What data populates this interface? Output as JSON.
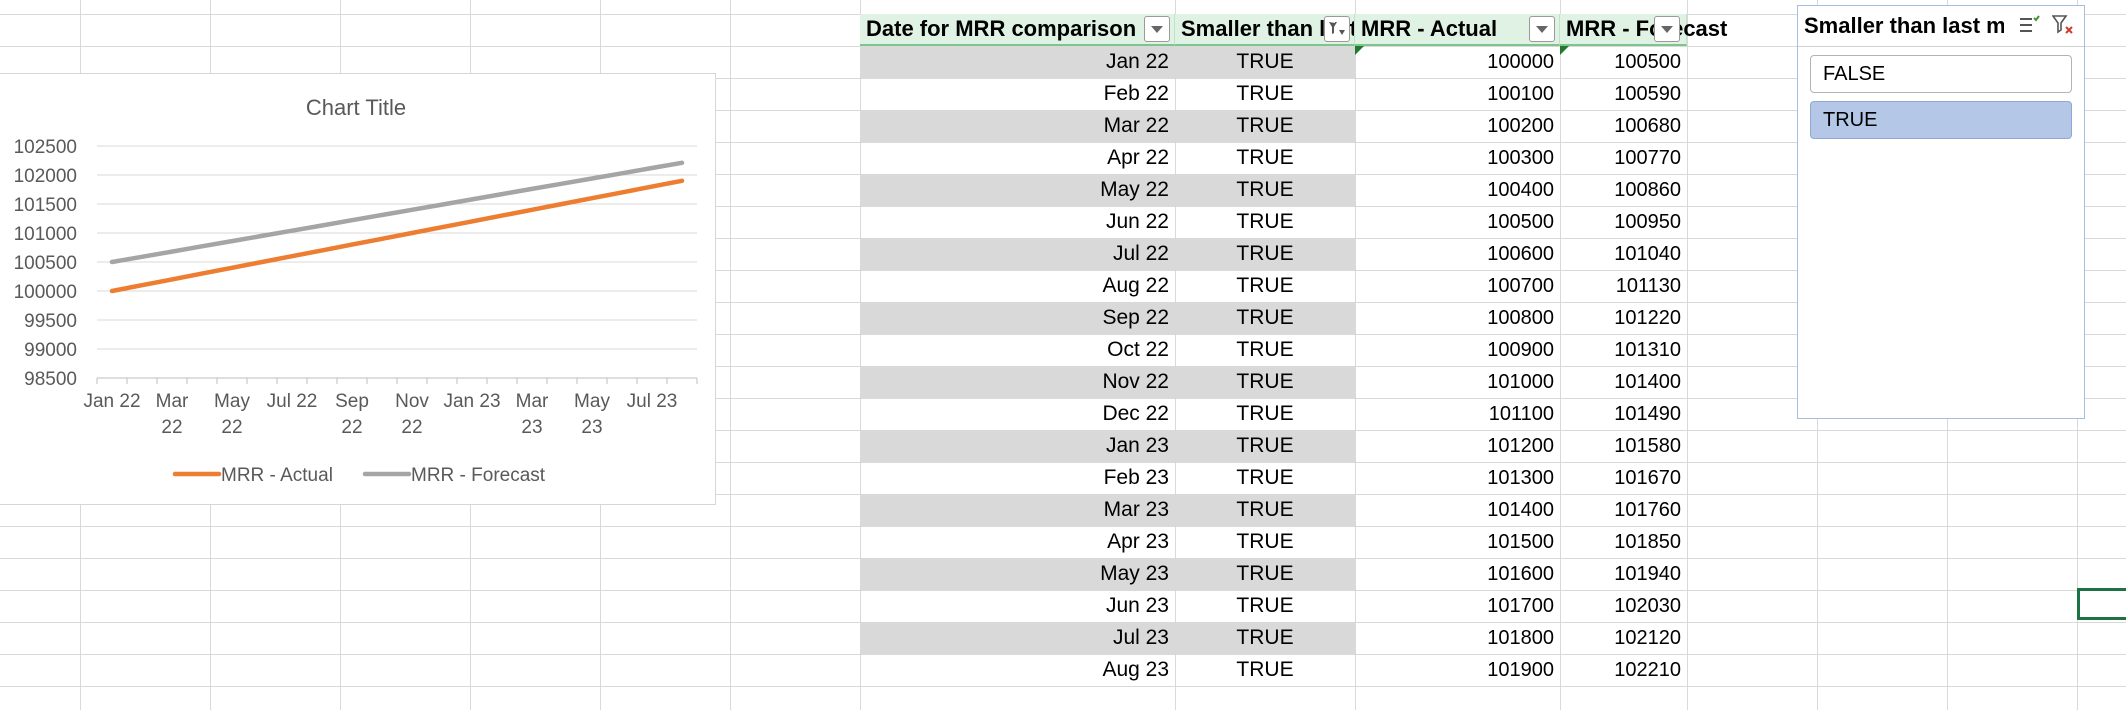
{
  "colors": {
    "actual": "#ed7d31",
    "forecast": "#a5a5a5",
    "header_fill": "#dff2e3",
    "band_fill": "#d9d9d9",
    "slicer_selected": "#b4c7e7",
    "active_cell": "#1e7145"
  },
  "chart_data": {
    "type": "line",
    "title": "Chart Title",
    "xlabel": "",
    "ylabel": "",
    "ylim": [
      98500,
      102500
    ],
    "yticks": [
      "102500",
      "102000",
      "101500",
      "101000",
      "100500",
      "100000",
      "99500",
      "99000",
      "98500"
    ],
    "categories": [
      "Jan 22",
      "Feb 22",
      "Mar 22",
      "Apr 22",
      "May 22",
      "Jun 22",
      "Jul 22",
      "Aug 22",
      "Sep 22",
      "Oct 22",
      "Nov 22",
      "Dec 22",
      "Jan 23",
      "Feb 23",
      "Mar 23",
      "Apr 23",
      "May 23",
      "Jun 23",
      "Jul 23",
      "Aug 23"
    ],
    "xtick_labels": [
      [
        "Jan 22"
      ],
      [
        "Mar",
        "22"
      ],
      [
        "May",
        "22"
      ],
      [
        "Jul 22"
      ],
      [
        "Sep",
        "22"
      ],
      [
        "Nov",
        "22"
      ],
      [
        "Jan 23"
      ],
      [
        "Mar",
        "23"
      ],
      [
        "May",
        "23"
      ],
      [
        "Jul 23"
      ]
    ],
    "series": [
      {
        "name": "MRR - Actual",
        "values": [
          100000,
          100100,
          100200,
          100300,
          100400,
          100500,
          100600,
          100700,
          100800,
          100900,
          101000,
          101100,
          101200,
          101300,
          101400,
          101500,
          101600,
          101700,
          101800,
          101900
        ]
      },
      {
        "name": "MRR - Forecast",
        "values": [
          100500,
          100590,
          100680,
          100770,
          100860,
          100950,
          101040,
          101130,
          101220,
          101310,
          101400,
          101490,
          101580,
          101670,
          101760,
          101850,
          101940,
          102030,
          102120,
          102210
        ]
      }
    ],
    "grid": true,
    "legend": "bottom"
  },
  "table": {
    "headers": [
      "Date for MRR comparison",
      "Smaller than last month",
      "MRR - Actual",
      "MRR - Forecast"
    ],
    "rows": [
      [
        "Jan 22",
        "TRUE",
        "100000",
        "100500"
      ],
      [
        "Feb 22",
        "TRUE",
        "100100",
        "100590"
      ],
      [
        "Mar 22",
        "TRUE",
        "100200",
        "100680"
      ],
      [
        "Apr 22",
        "TRUE",
        "100300",
        "100770"
      ],
      [
        "May 22",
        "TRUE",
        "100400",
        "100860"
      ],
      [
        "Jun 22",
        "TRUE",
        "100500",
        "100950"
      ],
      [
        "Jul 22",
        "TRUE",
        "100600",
        "101040"
      ],
      [
        "Aug 22",
        "TRUE",
        "100700",
        "101130"
      ],
      [
        "Sep 22",
        "TRUE",
        "100800",
        "101220"
      ],
      [
        "Oct 22",
        "TRUE",
        "100900",
        "101310"
      ],
      [
        "Nov 22",
        "TRUE",
        "101000",
        "101400"
      ],
      [
        "Dec 22",
        "TRUE",
        "101100",
        "101490"
      ],
      [
        "Jan 23",
        "TRUE",
        "101200",
        "101580"
      ],
      [
        "Feb 23",
        "TRUE",
        "101300",
        "101670"
      ],
      [
        "Mar 23",
        "TRUE",
        "101400",
        "101760"
      ],
      [
        "Apr 23",
        "TRUE",
        "101500",
        "101850"
      ],
      [
        "May 23",
        "TRUE",
        "101600",
        "101940"
      ],
      [
        "Jun 23",
        "TRUE",
        "101700",
        "102030"
      ],
      [
        "Jul 23",
        "TRUE",
        "101800",
        "102120"
      ],
      [
        "Aug 23",
        "TRUE",
        "101900",
        "102210"
      ]
    ]
  },
  "slicer": {
    "title": "Smaller than last mo...",
    "items": [
      {
        "label": "FALSE",
        "selected": false
      },
      {
        "label": "TRUE",
        "selected": true
      }
    ],
    "icons": [
      "multi-select-icon",
      "clear-filter-icon"
    ]
  }
}
